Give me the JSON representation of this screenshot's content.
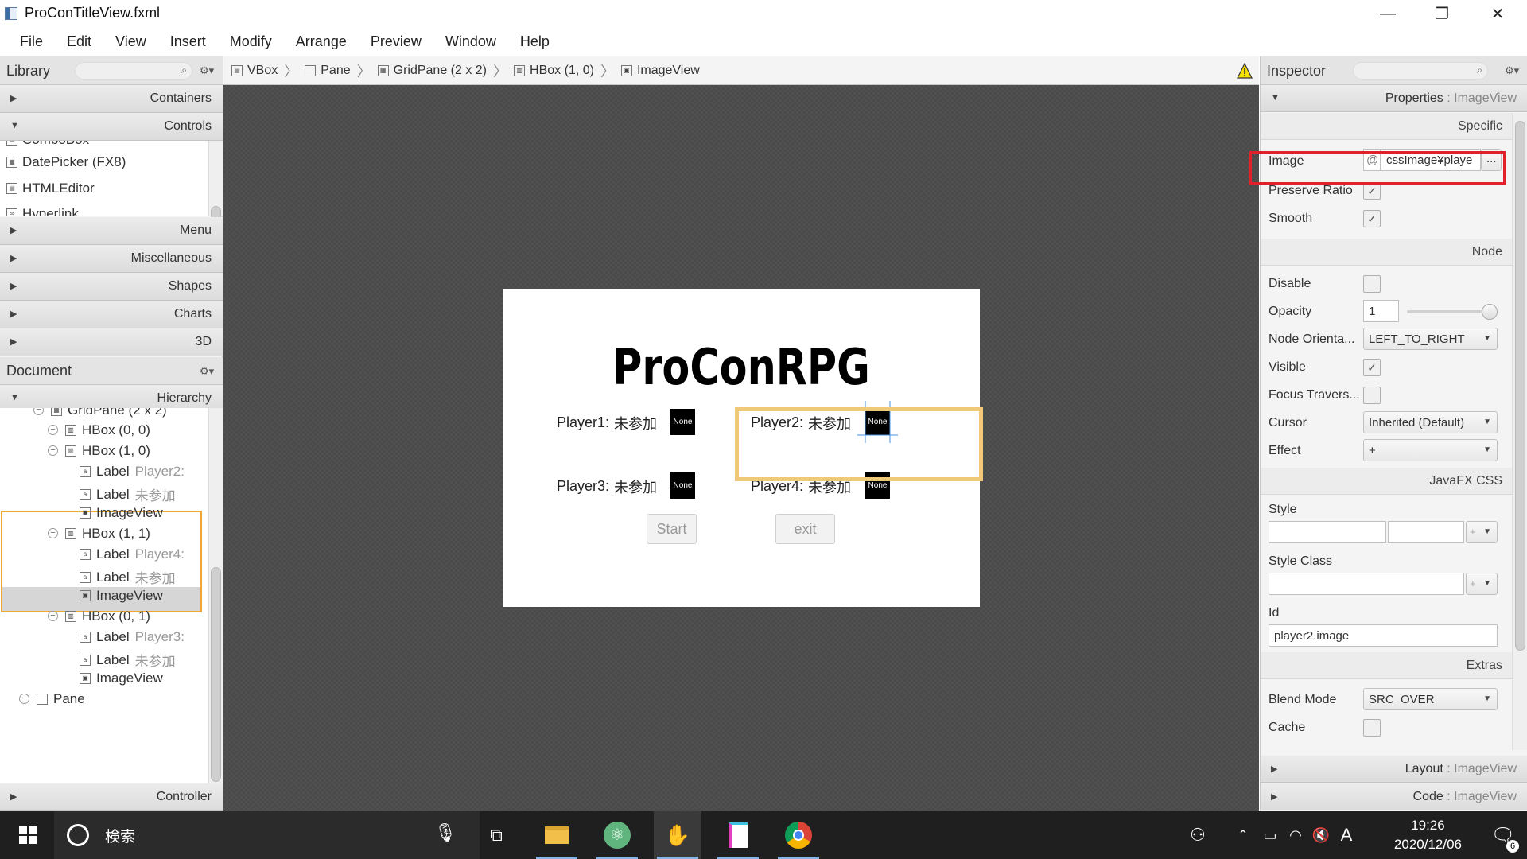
{
  "window": {
    "title": "ProConTitleView.fxml",
    "minimize": "—",
    "maximize": "❐",
    "close": "✕"
  },
  "menu": [
    "File",
    "Edit",
    "View",
    "Insert",
    "Modify",
    "Arrange",
    "Preview",
    "Window",
    "Help"
  ],
  "library": {
    "title": "Library",
    "sections": {
      "containers": "Containers",
      "controls": "Controls",
      "menu": "Menu",
      "misc": "Miscellaneous",
      "shapes": "Shapes",
      "charts": "Charts",
      "threed": "3D"
    },
    "controls_items": [
      "ComboBox",
      "DatePicker  (FX8)",
      "HTMLEditor",
      "Hyperlink"
    ]
  },
  "document": {
    "title": "Document",
    "hierarchy": "Hierarchy",
    "controller": "Controller",
    "tree": [
      {
        "label": "GridPane (2 x 2)",
        "extra": ""
      },
      {
        "label": "HBox (0, 0)",
        "extra": ""
      },
      {
        "label": "HBox (1, 0)",
        "extra": ""
      },
      {
        "label": "Label",
        "extra": "Player2:"
      },
      {
        "label": "Label",
        "extra": "未参加"
      },
      {
        "label": "ImageView",
        "extra": ""
      },
      {
        "label": "HBox (1, 1)",
        "extra": ""
      },
      {
        "label": "Label",
        "extra": "Player4:"
      },
      {
        "label": "Label",
        "extra": "未参加"
      },
      {
        "label": "ImageView",
        "extra": ""
      },
      {
        "label": "HBox (0, 1)",
        "extra": ""
      },
      {
        "label": "Label",
        "extra": "Player3:"
      },
      {
        "label": "Label",
        "extra": "未参加"
      },
      {
        "label": "ImageView",
        "extra": ""
      },
      {
        "label": "Pane",
        "extra": ""
      }
    ]
  },
  "breadcrumb": [
    "VBox",
    "Pane",
    "GridPane (2 x 2)",
    "HBox (1, 0)",
    "ImageView"
  ],
  "form": {
    "title": "ProConRPG",
    "players": [
      {
        "label": "Player1:",
        "status": "未参加",
        "img": "None"
      },
      {
        "label": "Player2:",
        "status": "未参加",
        "img": "None"
      },
      {
        "label": "Player3:",
        "status": "未参加",
        "img": "None"
      },
      {
        "label": "Player4:",
        "status": "未参加",
        "img": "None"
      }
    ],
    "start": "Start",
    "exit": "exit"
  },
  "inspector": {
    "title": "Inspector",
    "properties": "Properties",
    "layout": "Layout",
    "code": "Code",
    "target": " : ImageView",
    "sections": {
      "specific": "Specific",
      "node": "Node",
      "css": "JavaFX CSS",
      "extras": "Extras"
    },
    "image": {
      "label": "Image",
      "at": "@",
      "value": "cssImage¥playe",
      "browse": "..."
    },
    "preserve_ratio": "Preserve Ratio",
    "smooth": "Smooth",
    "disable": "Disable",
    "opacity": {
      "label": "Opacity",
      "value": "1",
      "level": 1.0
    },
    "node_orientation": {
      "label": "Node Orienta...",
      "value": "LEFT_TO_RIGHT"
    },
    "visible": "Visible",
    "focus": "Focus Travers...",
    "cursor": {
      "label": "Cursor",
      "value": "Inherited (Default)"
    },
    "effect": {
      "label": "Effect",
      "value": "+"
    },
    "style": "Style",
    "style_class": "Style Class",
    "id": {
      "label": "Id",
      "value": "player2.image"
    },
    "blend": {
      "label": "Blend Mode",
      "value": "SRC_OVER"
    },
    "cache": "Cache",
    "checkmark": "✓"
  },
  "taskbar": {
    "search": "検索",
    "time": "19:26",
    "date": "2020/12/06",
    "notif": "6"
  },
  "colors": {
    "selection": "#f0a830",
    "highlight": "#e0202a"
  }
}
